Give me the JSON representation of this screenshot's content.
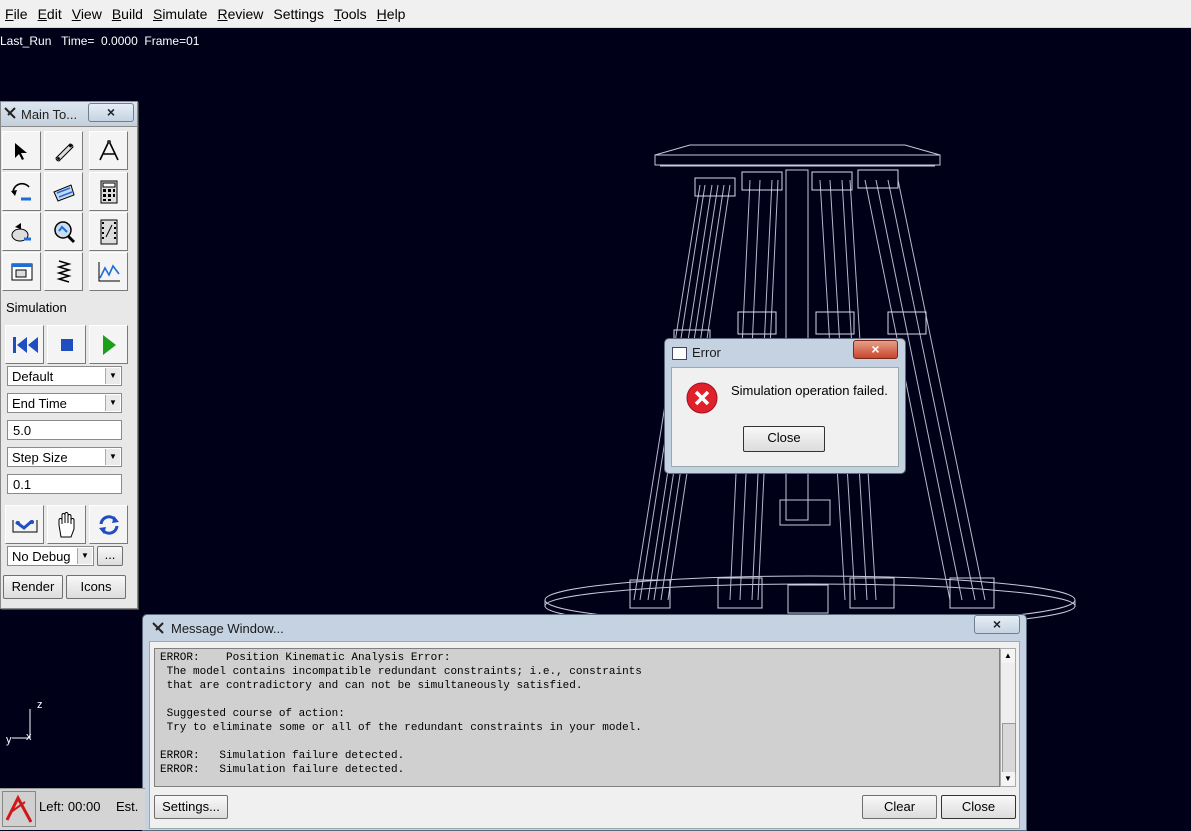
{
  "menu": [
    {
      "label": "File",
      "u": "F"
    },
    {
      "label": "Edit",
      "u": "E"
    },
    {
      "label": "View",
      "u": "V"
    },
    {
      "label": "Build",
      "u": "B"
    },
    {
      "label": "Simulate",
      "u": "S"
    },
    {
      "label": "Review",
      "u": "R"
    },
    {
      "label": "Settings",
      "u": ""
    },
    {
      "label": "Tools",
      "u": "T"
    },
    {
      "label": "Help",
      "u": "H"
    }
  ],
  "run_info": "Last_Run   Time=  0.0000  Frame=01",
  "toolbox": {
    "title": "Main To...",
    "close": "×",
    "section": "Simulation",
    "sim_mode": "Default",
    "end_label": "End Time",
    "end_value": "5.0",
    "step_label": "Step Size",
    "step_value": "0.1",
    "debug": "No Debug",
    "more": "...",
    "render": "Render",
    "icons": "Icons"
  },
  "axes": {
    "z": "z",
    "y": "y",
    "x": "x"
  },
  "error_dialog": {
    "title": "Error",
    "close": "×",
    "message": "Simulation operation failed.",
    "button": "Close"
  },
  "message_window": {
    "title": "Message Window...",
    "close": "×",
    "log": "ERROR:    Position Kinematic Analysis Error:\n The model contains incompatible redundant constraints; i.e., constraints\n that are contradictory and can not be simultaneously satisfied.\n\n Suggested course of action:\n Try to eliminate some or all of the redundant constraints in your model.\n\nERROR:   Simulation failure detected.\nERROR:   Simulation failure detected.",
    "settings": "Settings...",
    "clear": "Clear",
    "close_btn": "Close"
  },
  "status": {
    "left": "Left: 00:00",
    "est": "Est."
  },
  "colors": {
    "background": "#000018",
    "wireframe": "#c8c8d8",
    "error_icon": "#e0202a"
  }
}
